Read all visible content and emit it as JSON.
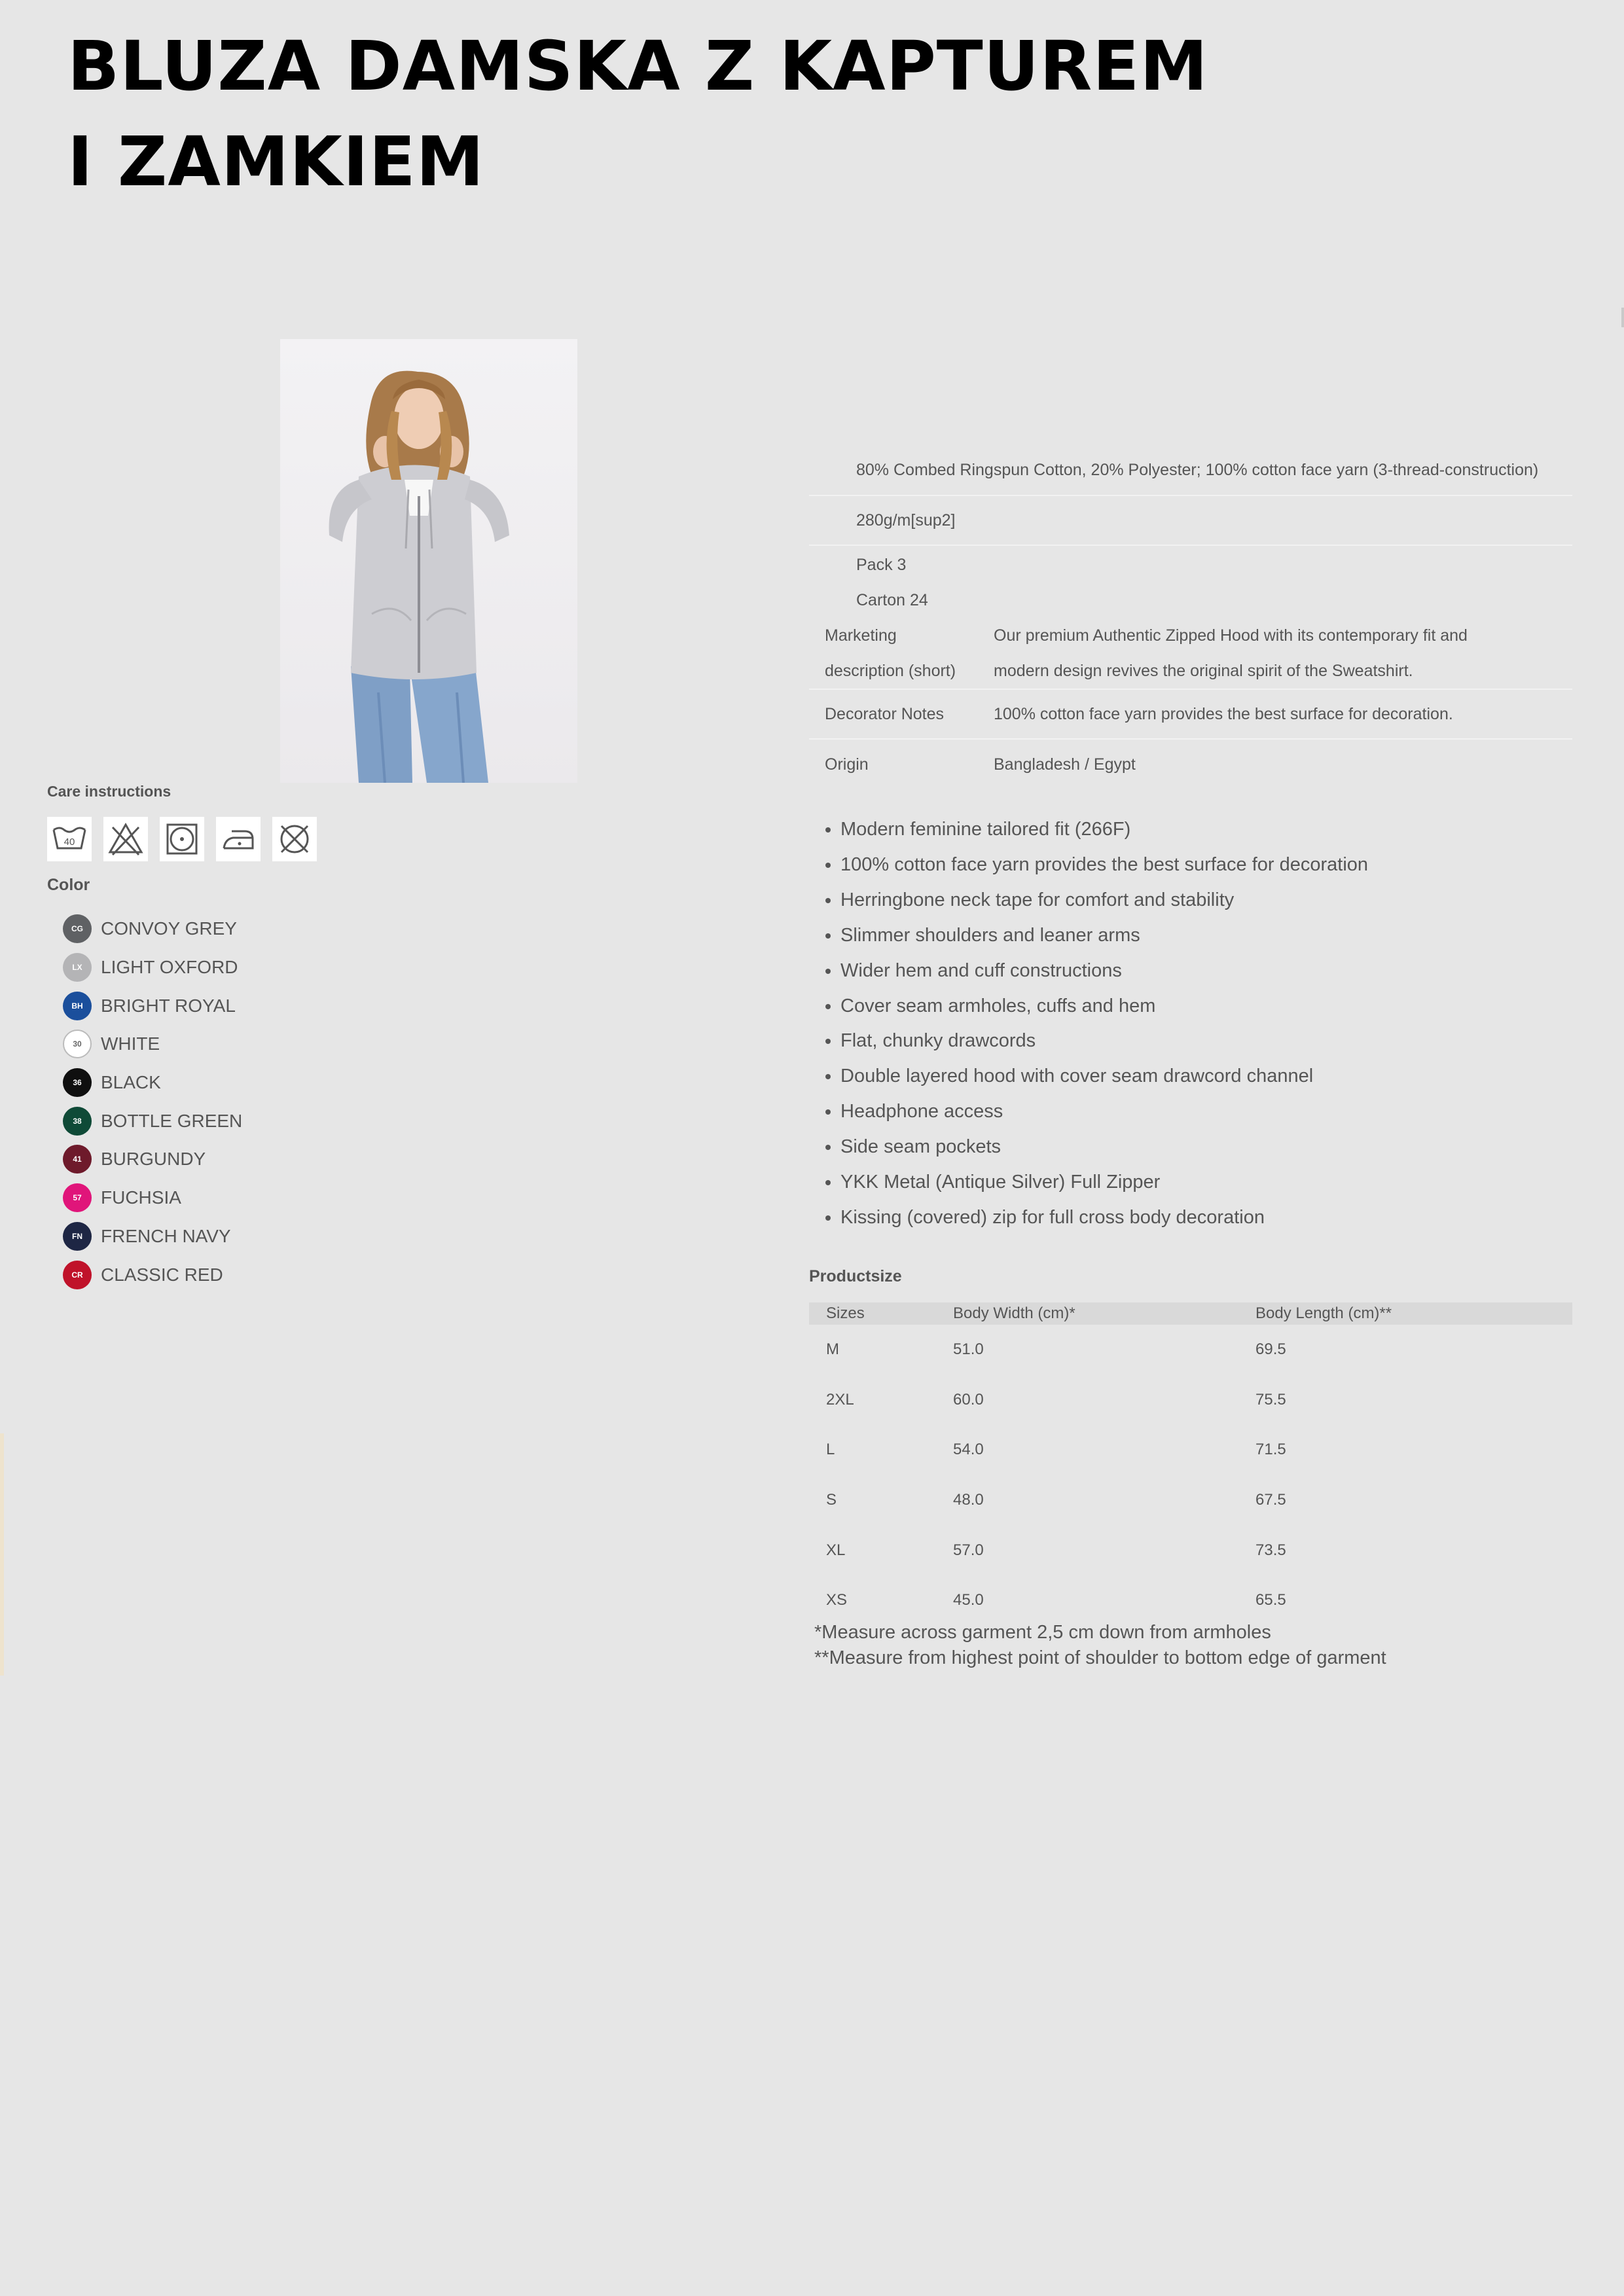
{
  "title": {
    "line1": "BLUZA DAMSKA Z KAPTUREM",
    "line2": "I ZAMKIEM"
  },
  "care": {
    "title": "Care instructions",
    "icons": [
      {
        "name": "wash-40-icon",
        "label": "40"
      },
      {
        "name": "no-bleach-icon"
      },
      {
        "name": "tumble-dry-low-icon"
      },
      {
        "name": "iron-low-icon"
      },
      {
        "name": "no-dry-clean-icon"
      }
    ]
  },
  "colors": {
    "title": "Color",
    "items": [
      {
        "code": "CG",
        "name": "CONVOY GREY",
        "hex": "#5f6164"
      },
      {
        "code": "LX",
        "name": "LIGHT OXFORD",
        "hex": "#b4b4b6"
      },
      {
        "code": "BH",
        "name": "BRIGHT ROYAL",
        "hex": "#1b4f9c"
      },
      {
        "code": "30",
        "name": "WHITE",
        "hex": "#ffffff"
      },
      {
        "code": "36",
        "name": "BLACK",
        "hex": "#0f0f0f"
      },
      {
        "code": "38",
        "name": "BOTTLE GREEN",
        "hex": "#0f4a37"
      },
      {
        "code": "41",
        "name": "BURGUNDY",
        "hex": "#6e1a2b"
      },
      {
        "code": "57",
        "name": "FUCHSIA",
        "hex": "#e0157a"
      },
      {
        "code": "FN",
        "name": "FRENCH NAVY",
        "hex": "#1e2644"
      },
      {
        "code": "CR",
        "name": "CLASSIC RED",
        "hex": "#c0122a"
      }
    ]
  },
  "spec": {
    "material": "80% Combed Ringspun Cotton, 20% Polyester; 100% cotton face yarn (3-thread-construction)",
    "weight": "280g/m[sup2]",
    "pack": "Pack 3",
    "carton": "Carton 24",
    "marketing_label_1": "Marketing",
    "marketing_label_2": "description (short)",
    "marketing_value_1": "Our premium Authentic Zipped Hood with its contemporary fit and",
    "marketing_value_2": "modern design revives the original spirit of the Sweatshirt.",
    "decorator_label": "Decorator Notes",
    "decorator_value": "100% cotton face yarn provides the best surface for decoration.",
    "origin_label": "Origin",
    "origin_value": "Bangladesh / Egypt"
  },
  "features": [
    "Modern feminine tailored fit (266F)",
    "100% cotton face yarn provides the best surface for decoration",
    "Herringbone neck tape for comfort and stability",
    "Slimmer shoulders and leaner arms",
    "Wider hem and cuff constructions",
    "Cover seam armholes, cuffs and hem",
    "Flat, chunky drawcords",
    "Double layered hood with cover seam drawcord channel",
    "Headphone access",
    "Side seam pockets",
    "YKK Metal (Antique Silver) Full Zipper",
    "Kissing (covered) zip for full cross body decoration"
  ],
  "sizes": {
    "title": "Productsize",
    "headers": [
      "Sizes",
      "Body Width (cm)*",
      "Body Length (cm)**"
    ],
    "rows": [
      [
        "M",
        "51.0",
        "69.5"
      ],
      [
        "2XL",
        "60.0",
        "75.5"
      ],
      [
        "L",
        "54.0",
        "71.5"
      ],
      [
        "S",
        "48.0",
        "67.5"
      ],
      [
        "XL",
        "57.0",
        "73.5"
      ],
      [
        "XS",
        "45.0",
        "65.5"
      ]
    ],
    "note_1": "*Measure across garment 2,5 cm down from armholes",
    "note_2": "**Measure from highest point of shoulder to bottom edge of garment"
  }
}
